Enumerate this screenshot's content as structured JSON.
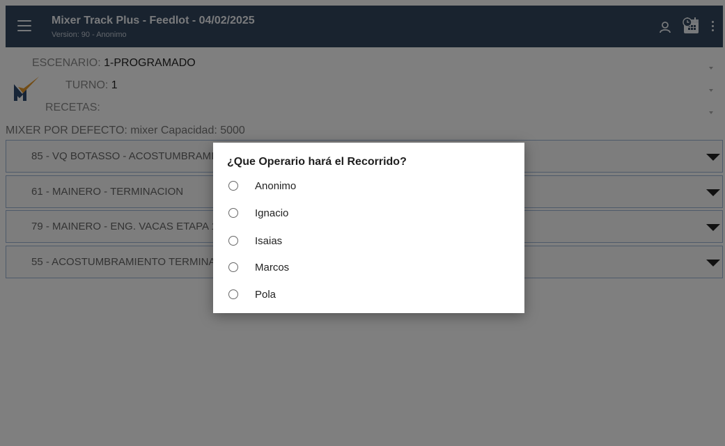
{
  "appbar": {
    "title": "Mixer Track Plus - Feedlot - 04/02/2025",
    "subtitle": "Version: 90 - Anonimo",
    "icons": [
      "menu-icon",
      "user-icon",
      "calendar-icon",
      "more-vert-icon"
    ]
  },
  "filters": {
    "escenario": {
      "label": "ESCENARIO:",
      "value": "1-PROGRAMADO"
    },
    "turno": {
      "label": "TURNO:",
      "value": "1"
    },
    "recetas": {
      "label": "RECETAS:",
      "value": ""
    }
  },
  "mixer_text": "MIXER POR DEFECTO: mixer Capacidad: 5000",
  "recipes": [
    "85 - VQ BOTASSO - ACOSTUMBRAMIENTO",
    "61 - MAINERO - TERMINACION",
    "79 - MAINERO - ENG. VACAS ETAPA 1",
    "55 - ACOSTUMBRAMIENTO TERMINACION"
  ],
  "dialog": {
    "title": "¿Que Operario hará el Recorrido?",
    "options": [
      "Anonimo",
      "Ignacio",
      "Isaias",
      "Marcos",
      "Pola"
    ]
  },
  "colors": {
    "appbar": "#33475e",
    "recipe_border": "#9db4d4",
    "logo_orange": "#e79a2d",
    "logo_blue": "#2f4a6e"
  }
}
